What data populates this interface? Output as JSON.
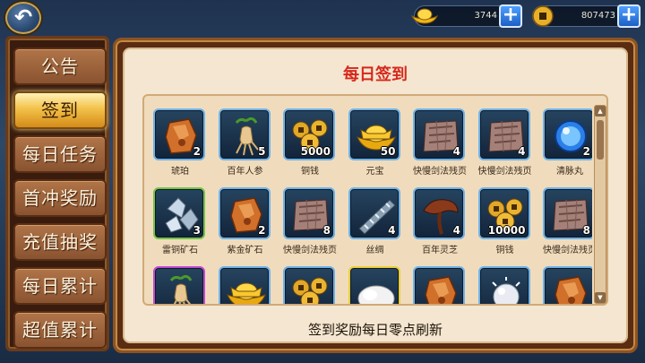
{
  "header": {
    "gold_amount": "3744",
    "coin_amount": "807473",
    "plus_symbol": "+",
    "back_symbol": "↶"
  },
  "sidebar": {
    "tabs": [
      {
        "label": "公告",
        "active": false
      },
      {
        "label": "签到",
        "active": true
      },
      {
        "label": "每日任务",
        "active": false
      },
      {
        "label": "首冲奖励",
        "active": false
      },
      {
        "label": "充值抽奖",
        "active": false
      },
      {
        "label": "每日累计",
        "active": false
      },
      {
        "label": "超值累计",
        "active": false
      }
    ]
  },
  "main": {
    "title": "每日签到",
    "footer": "签到奖励每日零点刷新",
    "scroll_up": "▲",
    "scroll_down": "▼",
    "items": [
      {
        "name": "琥珀",
        "count": "2",
        "icon": "amber-icon",
        "border": "blue"
      },
      {
        "name": "百年人参",
        "count": "5",
        "icon": "ginseng-icon",
        "border": "blue"
      },
      {
        "name": "铜钱",
        "count": "5000",
        "icon": "copper-coins-icon",
        "border": "blue"
      },
      {
        "name": "元宝",
        "count": "50",
        "icon": "gold-ingot-icon",
        "border": "blue"
      },
      {
        "name": "快慢剑法残页",
        "count": "4",
        "icon": "scroll-page-icon",
        "border": "blue"
      },
      {
        "name": "快慢剑法残页",
        "count": "4",
        "icon": "scroll-page-icon",
        "border": "blue"
      },
      {
        "name": "清脉丸",
        "count": "2",
        "icon": "blue-pill-icon",
        "border": "blue"
      },
      {
        "name": "雷铜矿石",
        "count": "3",
        "icon": "crystal-ore-icon",
        "border": "green"
      },
      {
        "name": "紫金矿石",
        "count": "2",
        "icon": "amber-icon",
        "border": "blue"
      },
      {
        "name": "快慢剑法残页",
        "count": "8",
        "icon": "scroll-page-icon",
        "border": "blue"
      },
      {
        "name": "丝绸",
        "count": "4",
        "icon": "silk-icon",
        "border": "blue"
      },
      {
        "name": "百年灵芝",
        "count": "4",
        "icon": "lingzhi-icon",
        "border": "blue"
      },
      {
        "name": "铜钱",
        "count": "10000",
        "icon": "copper-coins-icon",
        "border": "blue"
      },
      {
        "name": "快慢剑法残页",
        "count": "8",
        "icon": "scroll-page-icon",
        "border": "blue"
      },
      {
        "name": "",
        "count": "",
        "icon": "ginseng-icon",
        "border": "purple"
      },
      {
        "name": "",
        "count": "",
        "icon": "gold-ingot-icon",
        "border": "blue"
      },
      {
        "name": "",
        "count": "",
        "icon": "copper-coins-icon",
        "border": "blue"
      },
      {
        "name": "",
        "count": "",
        "icon": "silk-cloud-icon",
        "border": "yellow"
      },
      {
        "name": "",
        "count": "",
        "icon": "amber-icon",
        "border": "blue"
      },
      {
        "name": "",
        "count": "",
        "icon": "pearl-icon",
        "border": "blue"
      },
      {
        "name": "",
        "count": "",
        "icon": "amber-icon",
        "border": "blue"
      }
    ]
  },
  "colors": {
    "title_red": "#d6281c",
    "tab_active_gold": "#f3c24a",
    "slot_blue_border": "#6fb2e8"
  }
}
